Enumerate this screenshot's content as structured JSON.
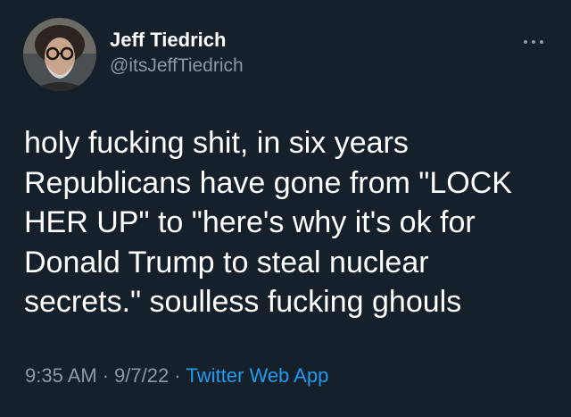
{
  "author": {
    "display_name": "Jeff Tiedrich",
    "handle": "@itsJeffTiedrich",
    "avatar_icon": "user-avatar-photo"
  },
  "menu": {
    "icon": "more-options-icon"
  },
  "tweet": {
    "lines": [
      "holy fucking shit, in six years",
      "Republicans have gone from \"LOCK",
      "HER UP\" to \"here's why it's ok for",
      "Donald Trump to steal nuclear",
      "secrets.\" soulless fucking ghouls"
    ]
  },
  "meta": {
    "time": "9:35 AM",
    "separator": "·",
    "date": "9/7/22",
    "source": "Twitter Web App"
  },
  "colors": {
    "background": "#15202b",
    "text": "#ffffff",
    "secondary": "#8b98a5",
    "accent": "#1d9bf0"
  }
}
